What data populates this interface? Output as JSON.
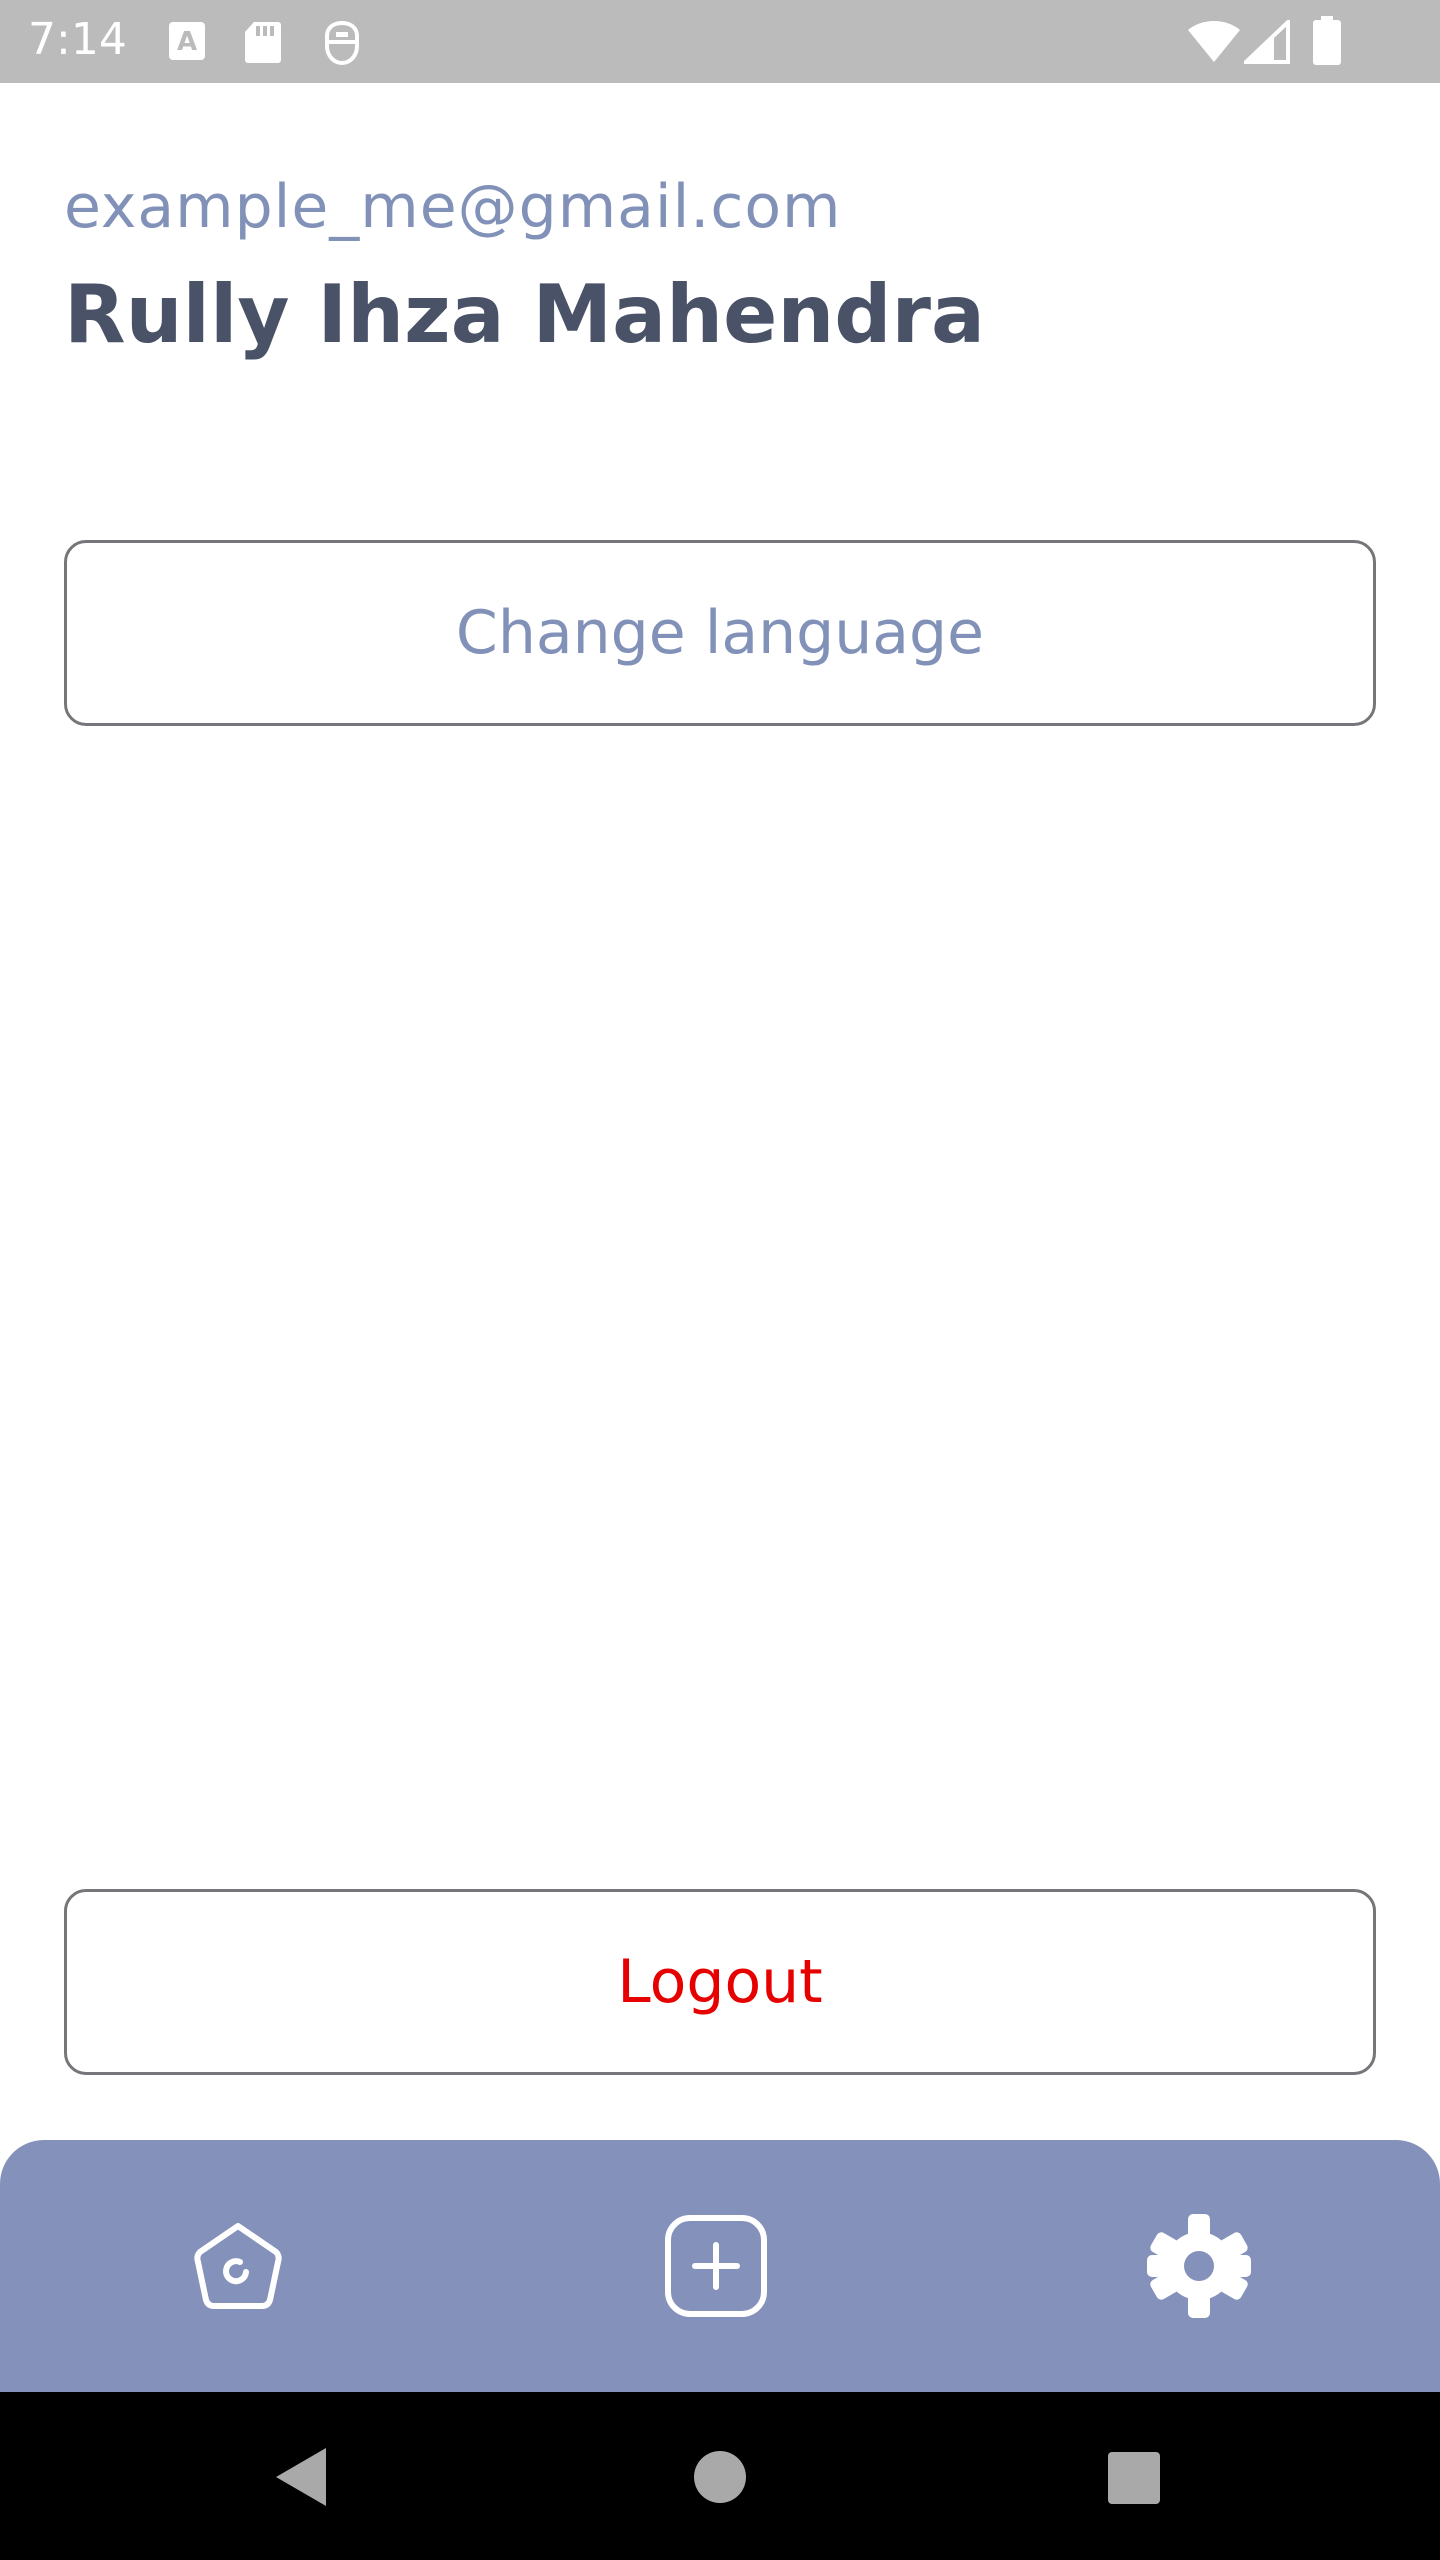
{
  "status_bar": {
    "time": "7:14",
    "icons": [
      "text-a-icon",
      "sd-card-icon",
      "security-icon",
      "wifi-icon",
      "signal-icon",
      "battery-icon"
    ]
  },
  "profile": {
    "email": "example_me@gmail.com",
    "name": "Rully Ihza Mahendra"
  },
  "actions": {
    "change_language_label": "Change language",
    "logout_label": "Logout"
  },
  "bottom_nav": {
    "items": [
      "home-icon",
      "add-icon",
      "settings-icon"
    ],
    "active": "settings-icon"
  },
  "system_nav": [
    "back-icon",
    "home-circle-icon",
    "recents-icon"
  ],
  "colors": {
    "status_bar": "#bcbbbc",
    "email": "#8191b8",
    "name": "#4a5268",
    "button_border": "#76767a",
    "language_text": "#8191b8",
    "logout_text": "#e60000",
    "bottom_nav": "#8491ba"
  }
}
